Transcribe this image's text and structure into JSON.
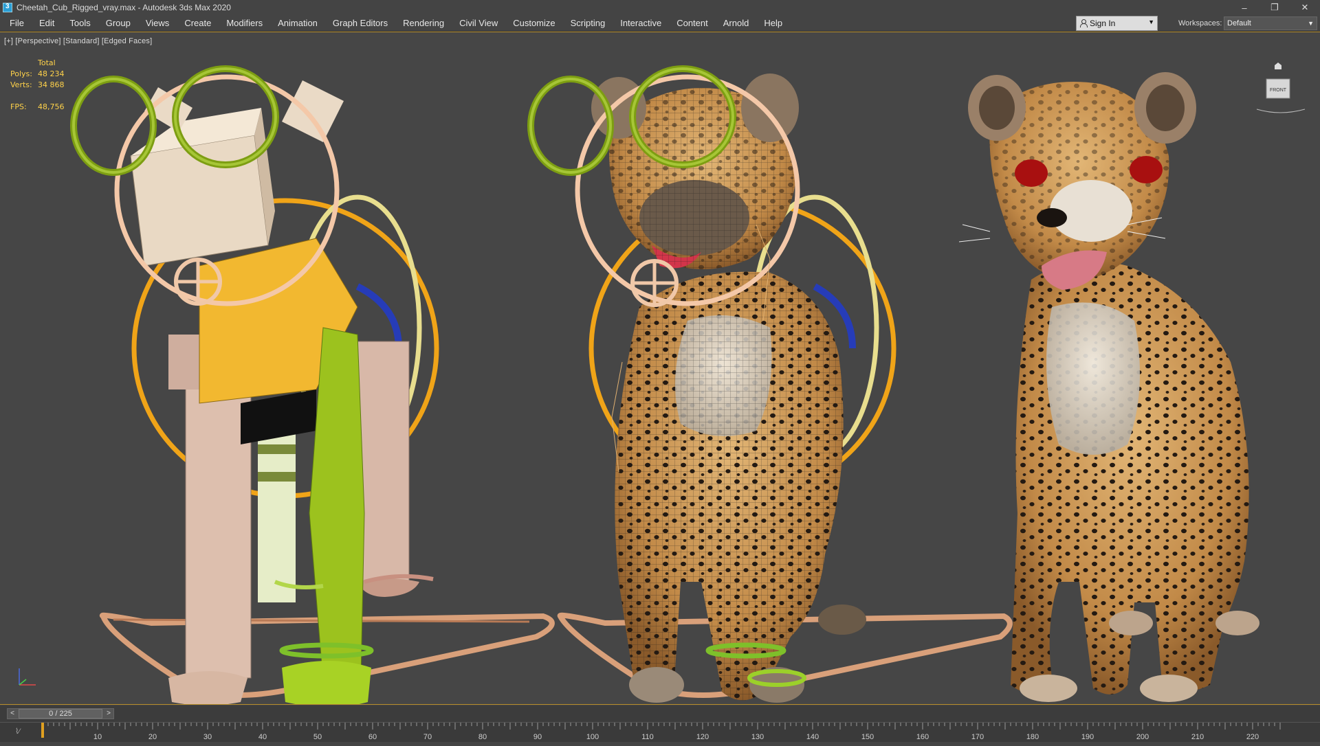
{
  "window": {
    "title": "Cheetah_Cub_Rigged_vray.max - Autodesk 3ds Max 2020",
    "minimize": "–",
    "maximize": "❐",
    "close": "✕"
  },
  "menu": {
    "items": [
      "File",
      "Edit",
      "Tools",
      "Group",
      "Views",
      "Create",
      "Modifiers",
      "Animation",
      "Graph Editors",
      "Rendering",
      "Civil View",
      "Customize",
      "Scripting",
      "Interactive",
      "Content",
      "Arnold",
      "Help"
    ],
    "sign_in": "Sign In",
    "workspaces_label": "Workspaces:",
    "workspace_value": "Default"
  },
  "viewport": {
    "label": "[+] [Perspective] [Standard] [Edged Faces]",
    "stats": {
      "header": "Total",
      "polys_label": "Polys:",
      "polys": "48 234",
      "verts_label": "Verts:",
      "verts": "34 868",
      "fps_label": "FPS:",
      "fps": "48,756"
    },
    "viewcube_label": "FRONT"
  },
  "timeline": {
    "frame": "0 / 225",
    "ticks": [
      "10",
      "20",
      "30",
      "40",
      "50",
      "60",
      "70",
      "80",
      "90",
      "100",
      "110",
      "120",
      "130",
      "140",
      "150",
      "160",
      "170",
      "180",
      "190",
      "200",
      "210",
      "220"
    ]
  },
  "colors": {
    "accent": "#b98f2a",
    "viewport_bg": "#464646",
    "stats_text": "#ffd24a"
  }
}
